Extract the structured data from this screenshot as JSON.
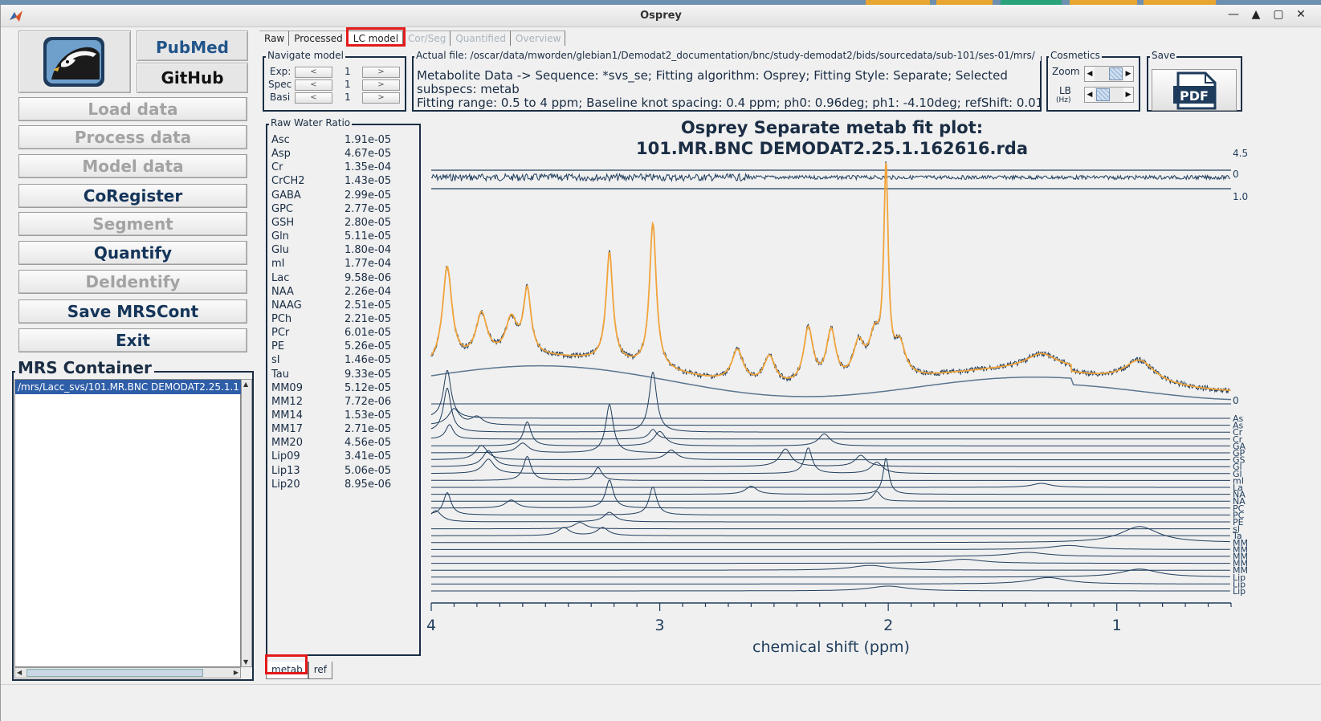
{
  "window": {
    "title": "Osprey",
    "controls": [
      "—",
      "▲",
      "▢",
      "✕"
    ]
  },
  "left": {
    "pubmed_label": "PubMed",
    "github_label": "GitHub",
    "buttons": [
      {
        "label": "Load data",
        "enabled": false
      },
      {
        "label": "Process data",
        "enabled": false
      },
      {
        "label": "Model data",
        "enabled": false
      },
      {
        "label": "CoRegister",
        "enabled": true
      },
      {
        "label": "Segment",
        "enabled": false
      },
      {
        "label": "Quantify",
        "enabled": true
      },
      {
        "label": "DeIdentify",
        "enabled": false
      },
      {
        "label": "Save MRSCont",
        "enabled": true
      },
      {
        "label": "Exit",
        "enabled": true
      }
    ],
    "container_title": "MRS Container",
    "container_item": "/mrs/Lacc_svs/101.MR.BNC DEMODAT2.25.1.1"
  },
  "tabs": [
    {
      "label": "Raw",
      "state": "normal"
    },
    {
      "label": "Processed",
      "state": "normal"
    },
    {
      "label": "LC model",
      "state": "selected"
    },
    {
      "label": "Cor/Seg",
      "state": "disabled"
    },
    {
      "label": "Quantified",
      "state": "disabled"
    },
    {
      "label": "Overview",
      "state": "disabled"
    }
  ],
  "navigate": {
    "title": "Navigate model",
    "rows": [
      {
        "label": "Exp:",
        "value": "1"
      },
      {
        "label": "Spec",
        "value": "1"
      },
      {
        "label": "Basi",
        "value": "1"
      }
    ],
    "prev": "<",
    "next": ">"
  },
  "actual_file": {
    "title": "Actual file: /oscar/data/mworden/glebian1/Demodat2_documentation/bnc/study-demodat2/bids/sourcedata/sub-101/ses-01/mrs/",
    "lines": [
      "Metabolite Data -> Sequence:  *svs_se; Fitting algorithm: Osprey; Fitting Style: Separate; Selected",
      "subspecs: metab",
      "Fitting range: 0.5 to 4 ppm; Baseline knot spacing: 0.4 ppm; ph0: 0.96deg; ph1: -4.10deg; refShift: 0.01"
    ]
  },
  "cosmetics": {
    "title": "Cosmetics",
    "zoom_label": "Zoom",
    "lb_label": "LB",
    "lb_unit": "(Hz)"
  },
  "save": {
    "title": "Save",
    "pdf_label": "PDF"
  },
  "ratio": {
    "title": "Raw Water Ratio",
    "rows": [
      {
        "m": "Asc",
        "v": "1.91e-05"
      },
      {
        "m": "Asp",
        "v": "4.67e-05"
      },
      {
        "m": "Cr",
        "v": "1.35e-04"
      },
      {
        "m": "CrCH2",
        "v": "1.43e-05"
      },
      {
        "m": "GABA",
        "v": "2.99e-05"
      },
      {
        "m": "GPC",
        "v": "2.77e-05"
      },
      {
        "m": "GSH",
        "v": "2.80e-05"
      },
      {
        "m": "Gln",
        "v": "5.11e-05"
      },
      {
        "m": "Glu",
        "v": "1.80e-04"
      },
      {
        "m": "mI",
        "v": "1.77e-04"
      },
      {
        "m": "Lac",
        "v": "9.58e-06"
      },
      {
        "m": "NAA",
        "v": "2.26e-04"
      },
      {
        "m": "NAAG",
        "v": "2.51e-05"
      },
      {
        "m": "PCh",
        "v": "2.21e-05"
      },
      {
        "m": "PCr",
        "v": "6.01e-05"
      },
      {
        "m": "PE",
        "v": "5.26e-05"
      },
      {
        "m": "sI",
        "v": "1.46e-05"
      },
      {
        "m": "Tau",
        "v": "9.33e-05"
      },
      {
        "m": "MM09",
        "v": "5.12e-05"
      },
      {
        "m": "MM12",
        "v": "7.72e-06"
      },
      {
        "m": "MM14",
        "v": "1.53e-05"
      },
      {
        "m": "MM17",
        "v": "2.71e-05"
      },
      {
        "m": "MM20",
        "v": "4.56e-05"
      },
      {
        "m": "Lip09",
        "v": "3.41e-05"
      },
      {
        "m": "Lip13",
        "v": "5.06e-05"
      },
      {
        "m": "Lip20",
        "v": "8.95e-06"
      }
    ]
  },
  "plot": {
    "title_line1": "Osprey Separate metab fit plot:",
    "title_line2": "101.MR.BNC DEMODAT2.25.1.162616.rda",
    "xlabel": "chemical shift (ppm)",
    "right_labels": [
      "4.5",
      "0",
      "1.0",
      "0"
    ],
    "basis_labels": [
      "As",
      "As",
      "Cr",
      "Cr",
      "GA",
      "GP",
      "GS",
      "Gl",
      "Gl",
      "mI",
      "La",
      "NA",
      "NA",
      "PC",
      "PC",
      "PE",
      "sI",
      "Ta",
      "MM",
      "MM",
      "MM",
      "MM",
      "MM",
      "Lip",
      "Lip",
      "Lip"
    ]
  },
  "chart_data": {
    "type": "line",
    "x_axis": {
      "ticks": [
        4,
        3,
        2,
        1
      ],
      "reversed": true,
      "xlim": [
        0.5,
        4
      ]
    },
    "xlabel": "chemical shift (ppm)",
    "series": [
      {
        "name": "data",
        "color": "#1f3d5c"
      },
      {
        "name": "fit",
        "color": "#f2a43a"
      },
      {
        "name": "baseline",
        "color": "#5a7590"
      }
    ],
    "peaks_ppm": [
      3.93,
      3.58,
      3.22,
      3.03,
      2.01,
      1.33,
      0.9
    ]
  },
  "bottom_tabs": [
    {
      "label": "metab",
      "selected": true
    },
    {
      "label": "ref",
      "selected": false
    }
  ],
  "colors": {
    "highlight": "#e41a1a",
    "fit": "#f2a43a",
    "data": "#1f3d5c",
    "selection": "#2f5ea8"
  }
}
